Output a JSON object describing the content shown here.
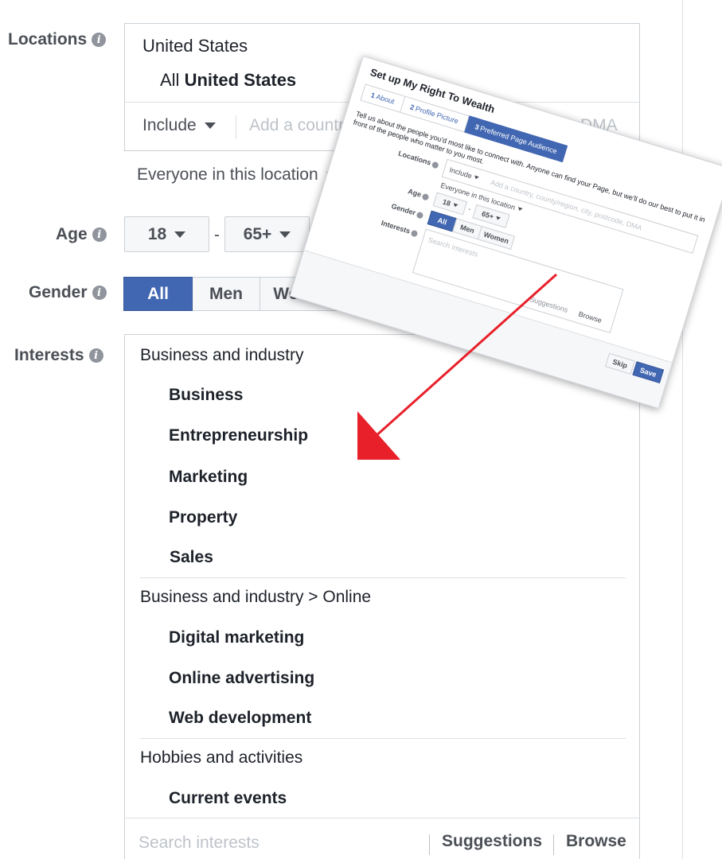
{
  "locations": {
    "label": "Locations",
    "country": "United States",
    "all_prefix": "All",
    "all_bold": "United States",
    "include_label": "Include",
    "input_placeholder": "Add a country, county/region, city, postcode, DMA",
    "scope": "Everyone in this location"
  },
  "age": {
    "label": "Age",
    "min": "18",
    "separator": "-",
    "max": "65+"
  },
  "gender": {
    "label": "Gender",
    "options": [
      "All",
      "Men",
      "Women"
    ],
    "selected": "All"
  },
  "interests": {
    "label": "Interests",
    "groups": [
      {
        "category": "Business and industry",
        "items": [
          "Business",
          "Entrepreneurship",
          "Marketing",
          "Property",
          "Sales"
        ]
      },
      {
        "category": "Business and industry > Online",
        "items": [
          "Digital marketing",
          "Online advertising",
          "Web development"
        ]
      },
      {
        "category": "Hobbies and activities",
        "items": [
          "Current events"
        ]
      }
    ],
    "search_placeholder": "Search interests",
    "suggestions": "Suggestions",
    "browse": "Browse"
  },
  "inset": {
    "title": "Set up My Right To Wealth",
    "steps": [
      {
        "num": "1",
        "label": "About"
      },
      {
        "num": "2",
        "label": "Profile Picture"
      },
      {
        "num": "3",
        "label": "Preferred Page Audience"
      }
    ],
    "active_step": 2,
    "intro": "Tell us about the people you'd most like to connect with. Anyone can find your Page, but we'll do our best to put it in front of the people who matter to you most.",
    "locations_label": "Locations",
    "include_label": "Include",
    "location_placeholder": "Add a country, county/region, city, postcode, DMA",
    "scope": "Everyone in this location",
    "age_label": "Age",
    "age_min": "18",
    "age_sep": "-",
    "age_max": "65+",
    "gender_label": "Gender",
    "gender_options": [
      "All",
      "Men",
      "Women"
    ],
    "interests_label": "Interests",
    "interests_placeholder": "Search interests",
    "suggestions": "Suggestions",
    "browse": "Browse",
    "skip": "Skip",
    "save": "Save"
  },
  "colors": {
    "accent": "#4267b2",
    "arrow": "#e8202a"
  }
}
